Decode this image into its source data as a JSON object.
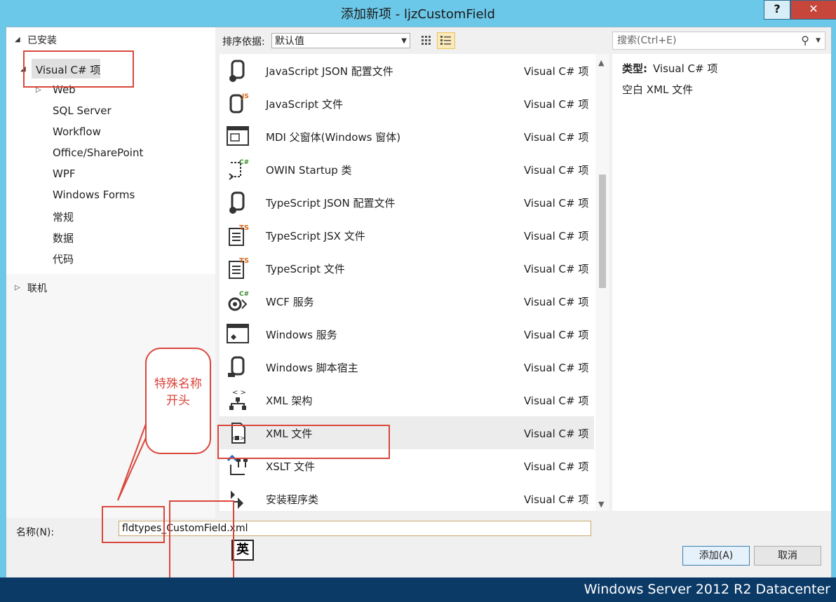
{
  "window": {
    "title": "添加新项 - ljzCustomField",
    "help_label": "?",
    "close_label": "✕"
  },
  "tree": {
    "installed_label": "已安装",
    "selected_node": "Visual C# 项",
    "children": [
      "Web",
      "SQL Server",
      "Workflow",
      "Office/SharePoint",
      "WPF",
      "Windows Forms",
      "常规",
      "数据",
      "代码"
    ],
    "online_label": "联机"
  },
  "toolbar": {
    "sort_label": "排序依据:",
    "sort_value": "默认值",
    "search_placeholder": "搜索(Ctrl+E)"
  },
  "items": [
    {
      "name": "JavaScript JSON 配置文件",
      "type": "Visual C# 项",
      "icon": "json-config-icon"
    },
    {
      "name": "JavaScript 文件",
      "type": "Visual C# 项",
      "icon": "javascript-file-icon"
    },
    {
      "name": "MDI 父窗体(Windows 窗体)",
      "type": "Visual C# 项",
      "icon": "mdi-form-icon"
    },
    {
      "name": "OWIN Startup 类",
      "type": "Visual C# 项",
      "icon": "owin-startup-icon"
    },
    {
      "name": "TypeScript JSON 配置文件",
      "type": "Visual C# 项",
      "icon": "typescript-json-icon"
    },
    {
      "name": "TypeScript JSX 文件",
      "type": "Visual C# 项",
      "icon": "typescript-jsx-icon"
    },
    {
      "name": "TypeScript 文件",
      "type": "Visual C# 项",
      "icon": "typescript-file-icon"
    },
    {
      "name": "WCF 服务",
      "type": "Visual C# 项",
      "icon": "wcf-service-icon"
    },
    {
      "name": "Windows 服务",
      "type": "Visual C# 项",
      "icon": "windows-service-icon"
    },
    {
      "name": "Windows 脚本宿主",
      "type": "Visual C# 项",
      "icon": "windows-script-host-icon"
    },
    {
      "name": "XML 架构",
      "type": "Visual C# 项",
      "icon": "xml-schema-icon"
    },
    {
      "name": "XML 文件",
      "type": "Visual C# 项",
      "icon": "xml-file-icon",
      "selected": true
    },
    {
      "name": "XSLT 文件",
      "type": "Visual C# 项",
      "icon": "xslt-file-icon"
    },
    {
      "name": "安装程序类",
      "type": "Visual C# 项",
      "icon": "installer-class-icon"
    }
  ],
  "details": {
    "type_key": "类型:",
    "type_value": "Visual C# 项",
    "description": "空白 XML 文件"
  },
  "name_field": {
    "label": "名称(N):",
    "value": "fldtypes_CustomField.xml"
  },
  "ime_indicator": "英",
  "buttons": {
    "add": "添加(A)",
    "cancel": "取消"
  },
  "annotation": {
    "callout_text": "特殊名称开头",
    "color": "#d9463b"
  },
  "status": {
    "os_label": "Windows Server 2012 R2 Datacenter"
  },
  "colors": {
    "title_bar": "#6cc8e8",
    "close_button": "#c7463b",
    "desktop": "#0b3a66"
  }
}
